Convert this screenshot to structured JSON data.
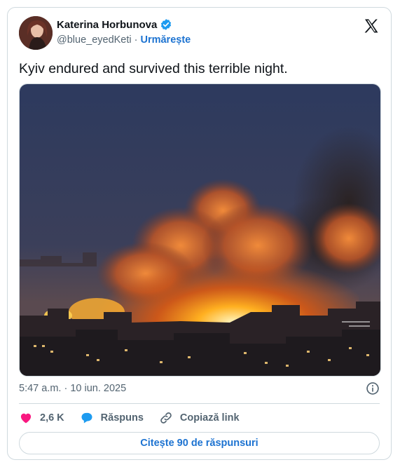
{
  "author": {
    "name": "Katerina Horbunova",
    "handle": "@blue_eyedKeti",
    "separator": "·",
    "follow_label": "Urmărește",
    "verified": true
  },
  "platform_icon": "x-logo-icon",
  "tweet": {
    "text": "Kyiv endured and survived this terrible night.",
    "media_description_icon": "photo",
    "timestamp": "5:47 a.m. · 10 iun. 2025"
  },
  "actions": {
    "likes_count": "2,6 K",
    "reply_label": "Răspuns",
    "copy_link_label": "Copiază link"
  },
  "read_replies_label": "Citește 90 de răspunsuri",
  "colors": {
    "accent": "#1d73d1",
    "like": "#f91880",
    "reply": "#1d9bf0",
    "muted": "#536471"
  }
}
